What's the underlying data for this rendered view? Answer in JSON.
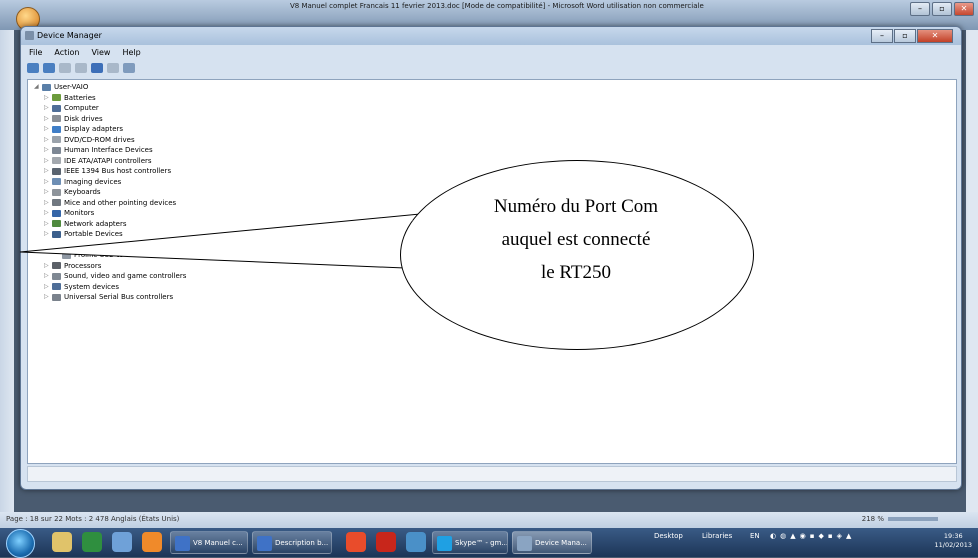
{
  "word": {
    "title": "V8 Manuel complet  Francais 11 fevrier 2013.doc [Mode de compatibilité] - Microsoft Word utilisation non commerciale",
    "status_left": "Page : 18 sur 22   Mots : 2 478   Anglais (États Unis)",
    "zoom": "218 %"
  },
  "device_manager": {
    "title": "Device Manager",
    "menu": [
      "File",
      "Action",
      "View",
      "Help"
    ],
    "root": "User-VAIO",
    "categories": [
      "Batteries",
      "Computer",
      "Disk drives",
      "Display adapters",
      "DVD/CD-ROM drives",
      "Human Interface Devices",
      "IDE ATA/ATAPI controllers",
      "IEEE 1394 Bus host controllers",
      "Imaging devices",
      "Keyboards",
      "Mice and other pointing devices",
      "Monitors",
      "Network adapters",
      "Portable Devices"
    ],
    "port_device": "Prolific USB-to-Serial Comm Port (COM5)",
    "categories_after": [
      "Processors",
      "Sound, video and game controllers",
      "System devices",
      "Universal Serial Bus controllers"
    ]
  },
  "callout": {
    "line1": "Numéro du Port Com",
    "line2": "auquel est connecté",
    "line3": "le RT250"
  },
  "taskbar": {
    "buttons": [
      "V8 Manuel c...",
      "Description b...",
      "Skype™ - gm...",
      "Device Mana..."
    ],
    "desktop_label": "Desktop",
    "libraries_label": "Libraries",
    "lang": "EN",
    "time": "19:36",
    "date": "11/02/2013"
  }
}
